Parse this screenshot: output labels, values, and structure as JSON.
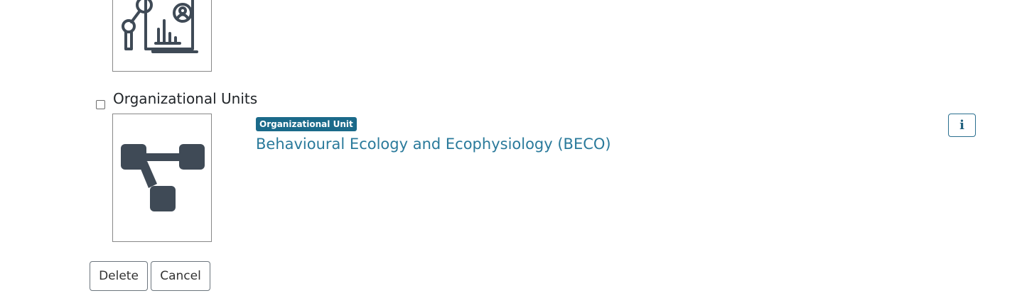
{
  "section": {
    "title": "Organizational Units",
    "checkbox_checked": false
  },
  "item": {
    "badge": "Organizational Unit",
    "title": "Behavioural Ecology and Ecophysiology (BECO)",
    "info_label": "i",
    "icon": "org-chart-icon"
  },
  "previous_item": {
    "icon": "analytics-report-icon"
  },
  "actions": {
    "delete_label": "Delete",
    "cancel_label": "Cancel"
  },
  "colors": {
    "badge_bg": "#1b6a8a",
    "link": "#2a7a9b",
    "icon": "#3f4a56"
  }
}
